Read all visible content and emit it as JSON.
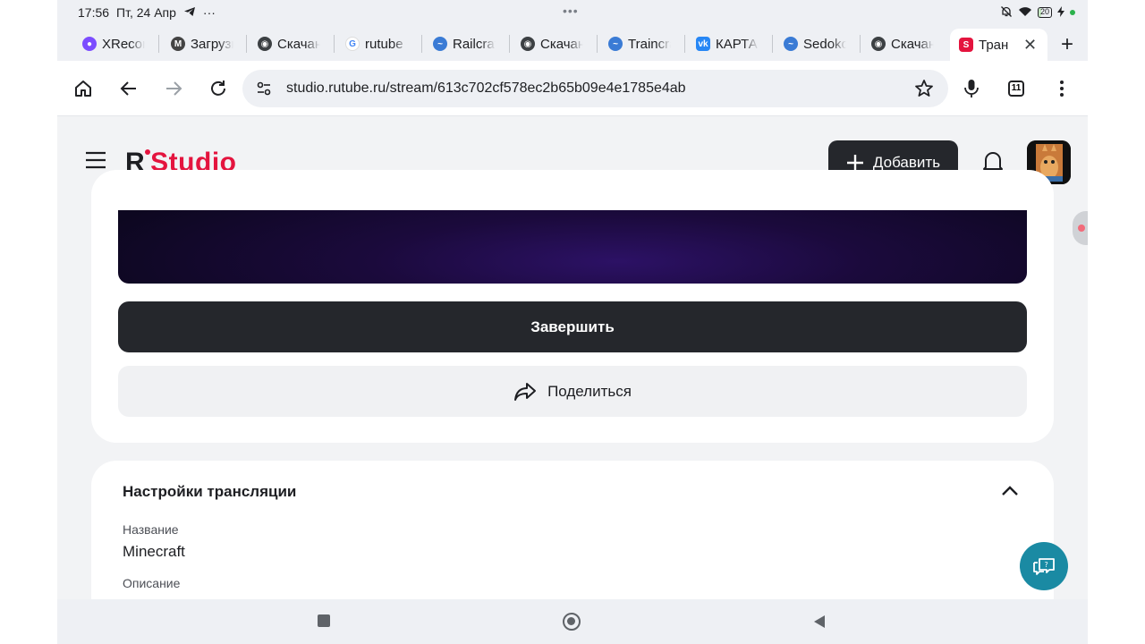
{
  "status": {
    "time": "17:56",
    "date": "Пт, 24 Апр",
    "more": "···",
    "center_dots": "•••",
    "battery": "20"
  },
  "tabs": [
    {
      "label": "XRecorder",
      "icon": "xrecorder-icon",
      "color": "#7c4dff"
    },
    {
      "label": "Загрузка",
      "icon": "m-icon",
      "color": "#333333"
    },
    {
      "label": "Скачано",
      "icon": "chrome-icon",
      "color": "#3c4043"
    },
    {
      "label": "rutube",
      "icon": "google-icon",
      "color": "#4285f4"
    },
    {
      "label": "Railcraft",
      "icon": "curseforge-icon",
      "color": "#3a7bd5"
    },
    {
      "label": "Скачано",
      "icon": "chrome-icon",
      "color": "#3c4043"
    },
    {
      "label": "Traincraft",
      "icon": "curseforge-icon",
      "color": "#3a7bd5"
    },
    {
      "label": "КАРТА",
      "icon": "vk-icon",
      "color": "#2787f5"
    },
    {
      "label": "Sedoko",
      "icon": "curseforge-icon",
      "color": "#3a7bd5"
    },
    {
      "label": "Скачано",
      "icon": "chrome-icon",
      "color": "#3c4043"
    }
  ],
  "active_tab": {
    "label": "Тран",
    "icon": "rutube-studio-icon",
    "color": "#e4143e"
  },
  "url": "studio.rutube.ru/stream/613c702cf578ec2b65b09e4e1785e4ab",
  "tab_count": "11",
  "header": {
    "logo_r": "R",
    "logo_studio": "Studio",
    "add_label": "Добавить"
  },
  "stream": {
    "finish_label": "Завершить",
    "share_label": "Поделиться"
  },
  "settings": {
    "title": "Настройки трансляции",
    "name_label": "Название",
    "name_value": "Minecraft",
    "description_label": "Описание"
  }
}
